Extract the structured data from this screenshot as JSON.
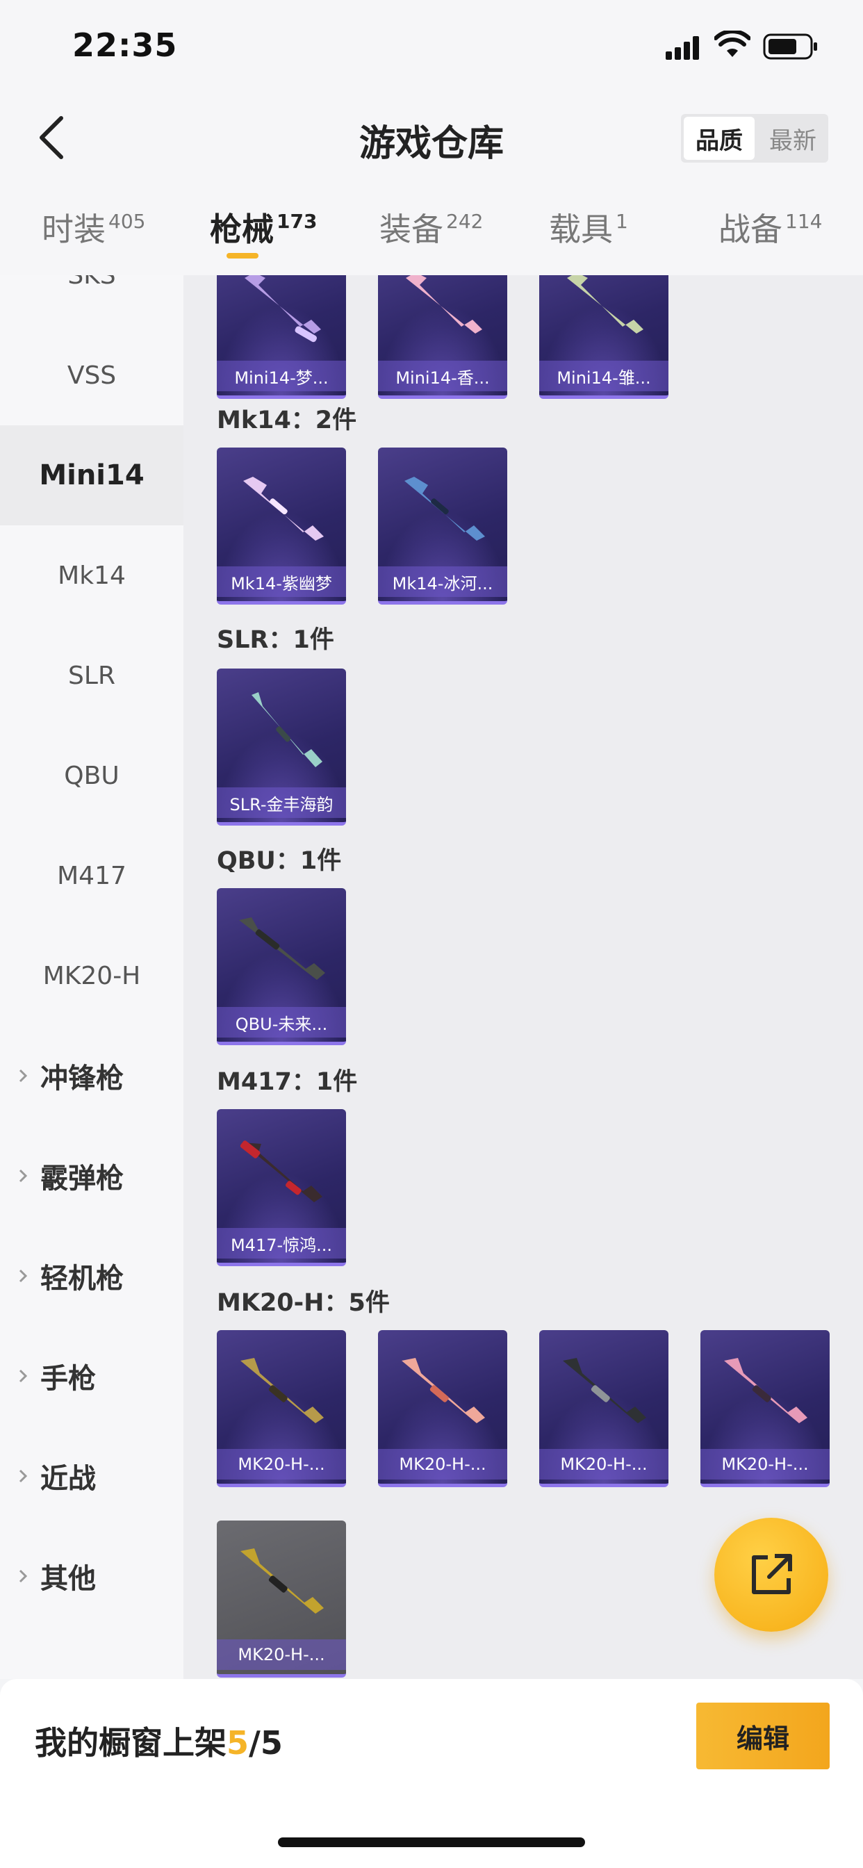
{
  "status": {
    "time": "22:35"
  },
  "header": {
    "title": "游戏仓库",
    "sort_quality": "品质",
    "sort_newest": "最新"
  },
  "tabs": [
    {
      "label": "时装",
      "count": "405"
    },
    {
      "label": "枪械",
      "count": "173"
    },
    {
      "label": "装备",
      "count": "242"
    },
    {
      "label": "载具",
      "count": "1"
    },
    {
      "label": "战备",
      "count": "114"
    }
  ],
  "sidebar": {
    "items": [
      "SKS",
      "VSS",
      "Mini14",
      "Mk14",
      "SLR",
      "QBU",
      "M417",
      "MK20-H"
    ],
    "groups": [
      "冲锋枪",
      "霰弹枪",
      "轻机枪",
      "手枪",
      "近战",
      "其他"
    ]
  },
  "groups": [
    {
      "title": "",
      "cards": [
        "Mini14-梦...",
        "Mini14-香...",
        "Mini14-雏..."
      ]
    },
    {
      "title": "Mk14：2件",
      "cards": [
        "Mk14-紫幽梦",
        "Mk14-冰河..."
      ]
    },
    {
      "title": "SLR：1件",
      "cards": [
        "SLR-金丰海韵"
      ]
    },
    {
      "title": "QBU：1件",
      "cards": [
        "QBU-未来..."
      ]
    },
    {
      "title": "M417：1件",
      "cards": [
        "M417-惊鸿..."
      ]
    },
    {
      "title": "MK20-H：5件",
      "cards": [
        "MK20-H-...",
        "MK20-H-...",
        "MK20-H-...",
        "MK20-H-...",
        "MK20-H-..."
      ]
    }
  ],
  "bottom": {
    "showcase_label": "我的橱窗上架",
    "showcase_used": "5",
    "showcase_total": "/5",
    "edit_label": "编辑"
  },
  "colors": {
    "accent": "#f5b428",
    "card_bg": "#2d2666",
    "card_border": "#8d75ea"
  },
  "icons": {
    "back": "chevron-left-icon",
    "share": "share-external-icon",
    "expand": "chevron-right-icon"
  }
}
